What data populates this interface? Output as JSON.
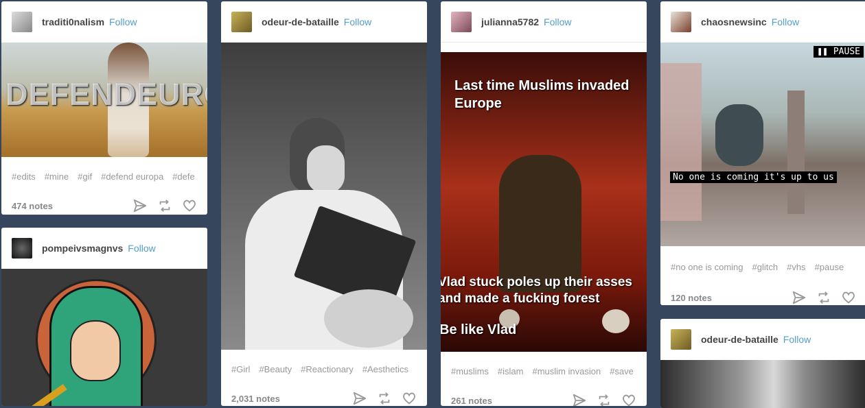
{
  "follow_label": "Follow",
  "posts": [
    {
      "username": "traditi0nalism",
      "overlay": "DEFENDEUROPA",
      "tags": [
        "#edits",
        "#mine",
        "#gif",
        "#defend europa",
        "#defe"
      ],
      "notes": "474 notes"
    },
    {
      "username": "pompeivsmagnvs"
    },
    {
      "username": "odeur-de-bataille",
      "tags": [
        "#Girl",
        "#Beauty",
        "#Reactionary",
        "#Aesthetics"
      ],
      "notes": "2,031 notes"
    },
    {
      "username": "julianna5782",
      "caption_top": "Last time Muslims invaded Europe",
      "caption_mid": "Vlad stuck poles up their asses and made a fucking forest",
      "caption_bottom": "Be like Vlad",
      "tags": [
        "#muslims",
        "#islam",
        "#muslim invasion",
        "#save"
      ],
      "notes": "261 notes"
    },
    {
      "username": "chaosnewsinc",
      "pause_label": "PAUSE",
      "subtitle": "No one is coming it's up to us",
      "tags": [
        "#no one is coming",
        "#glitch",
        "#vhs",
        "#pause"
      ],
      "notes": "120 notes"
    },
    {
      "username": "odeur-de-bataille"
    }
  ],
  "icons": {
    "share": "paper-plane-icon",
    "reblog": "reblog-icon",
    "like": "heart-icon"
  }
}
